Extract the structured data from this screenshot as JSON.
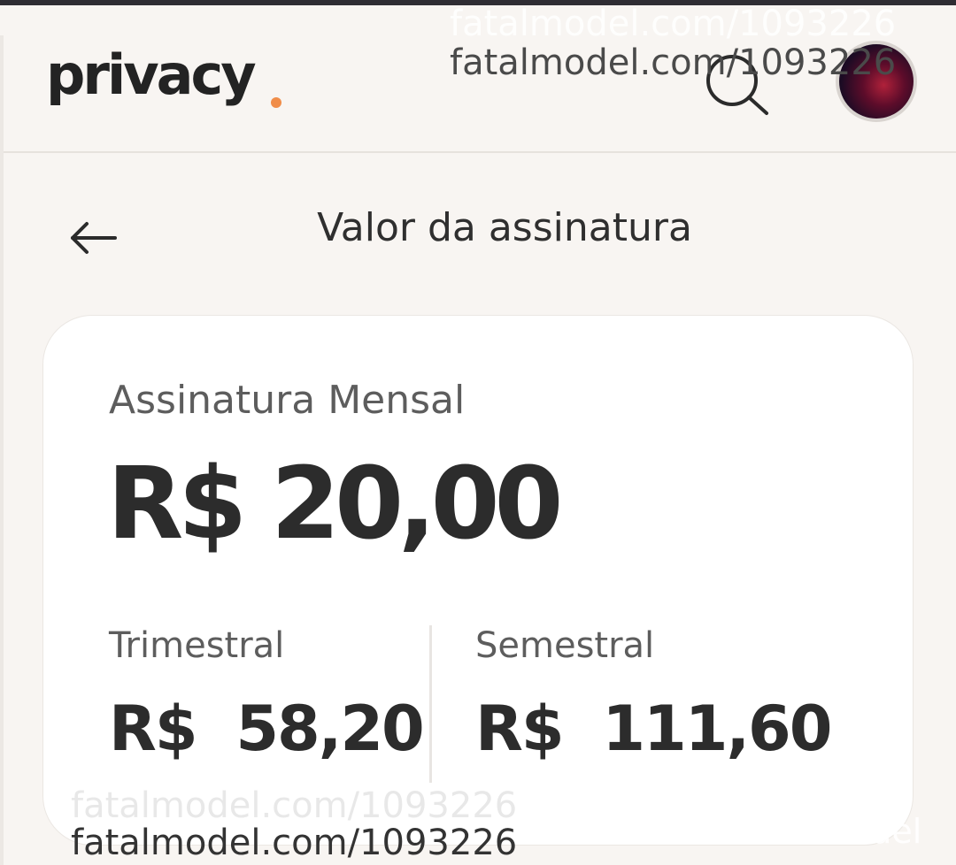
{
  "header": {
    "logo_text": "privacy",
    "search_icon": "search-icon",
    "avatar_icon": "user-avatar"
  },
  "page": {
    "title": "Valor da assinatura",
    "back_icon": "arrow-left-icon"
  },
  "subscription": {
    "monthly": {
      "label": "Assinatura Mensal",
      "price": "R$ 20,00"
    },
    "options": [
      {
        "label": "Trimestral",
        "price": "R$  58,20"
      },
      {
        "label": "Semestral",
        "price": "R$  111,60"
      }
    ]
  },
  "watermarks": {
    "top": "fatalmodel.com/1093226",
    "bottom": "fatalmodel.com/1093226",
    "right": "odel"
  },
  "colors": {
    "background": "#f8f5f2",
    "card": "#ffffff",
    "logo_dot": "#f08d49",
    "text_dark": "#2c2c2c",
    "text_muted": "#5d5d5d"
  }
}
